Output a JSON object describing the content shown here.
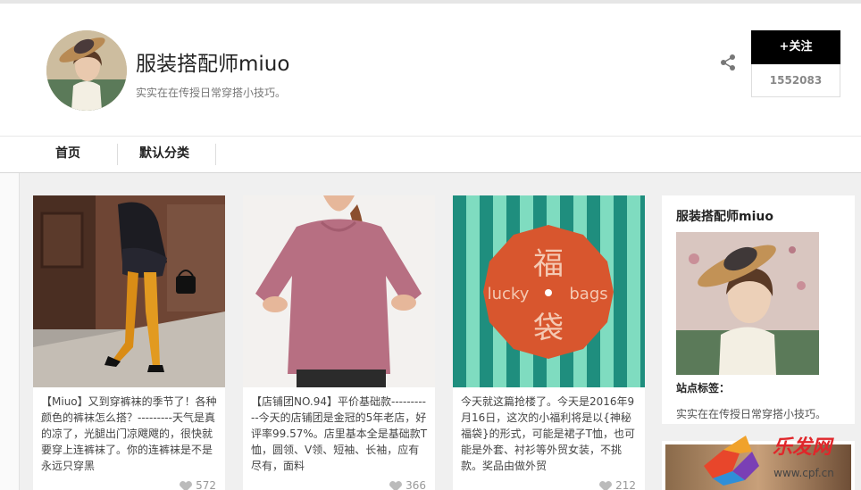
{
  "header": {
    "title": "服装搭配师miuo",
    "description": "实实在在传授日常穿搭小技巧。",
    "follow_label": "+关注",
    "follow_count": "1552083"
  },
  "nav": {
    "items": [
      {
        "label": "首页"
      },
      {
        "label": "默认分类"
      }
    ]
  },
  "posts": [
    {
      "text": "【Miuo】又到穿裤袜的季节了！各种颜色的裤袜怎么搭？---------天气是真的凉了，光腿出门凉飕飕的，很快就要穿上连裤袜了。你的连裤袜是不是永远只穿黑",
      "likes": "572"
    },
    {
      "text": "【店铺团NO.94】平价基础款-----------今天的店铺团是金冠的5年老店，好评率99.57%。店里基本全是基础款T恤，圆领、V领、短袖、长袖，应有尽有，面料",
      "likes": "366"
    },
    {
      "text": "今天就这篇抢楼了。今天是2016年9月16日，这次的小福利将是以{神秘福袋}的形式，可能是裙子T恤，也可能是外套、衬衫等外贸女装，不挑款。奖品由做外贸",
      "likes": "212"
    }
  ],
  "lucky_bag": {
    "big_top": "福",
    "word_left": "lucky",
    "word_right": "bags",
    "big_bottom": "袋"
  },
  "sidebar": {
    "title": "服装搭配师miuo",
    "tag_label": "站点标签：",
    "desc": "实实在在传授日常穿搭小技巧。"
  },
  "watermark": {
    "name": "乐发网",
    "url": "www.cpf.cn"
  },
  "colors": {
    "follow_bg": "#000000",
    "page_bg": "#f0f0f0",
    "lucky_orange": "#d8562e",
    "lucky_teal_dark": "#1f8e7e",
    "lucky_teal_light": "#7fdcc0",
    "shirt_pink": "#b76f82",
    "tights_orange": "#d98c16"
  },
  "icons": [
    "share-icon",
    "heart-icon"
  ]
}
